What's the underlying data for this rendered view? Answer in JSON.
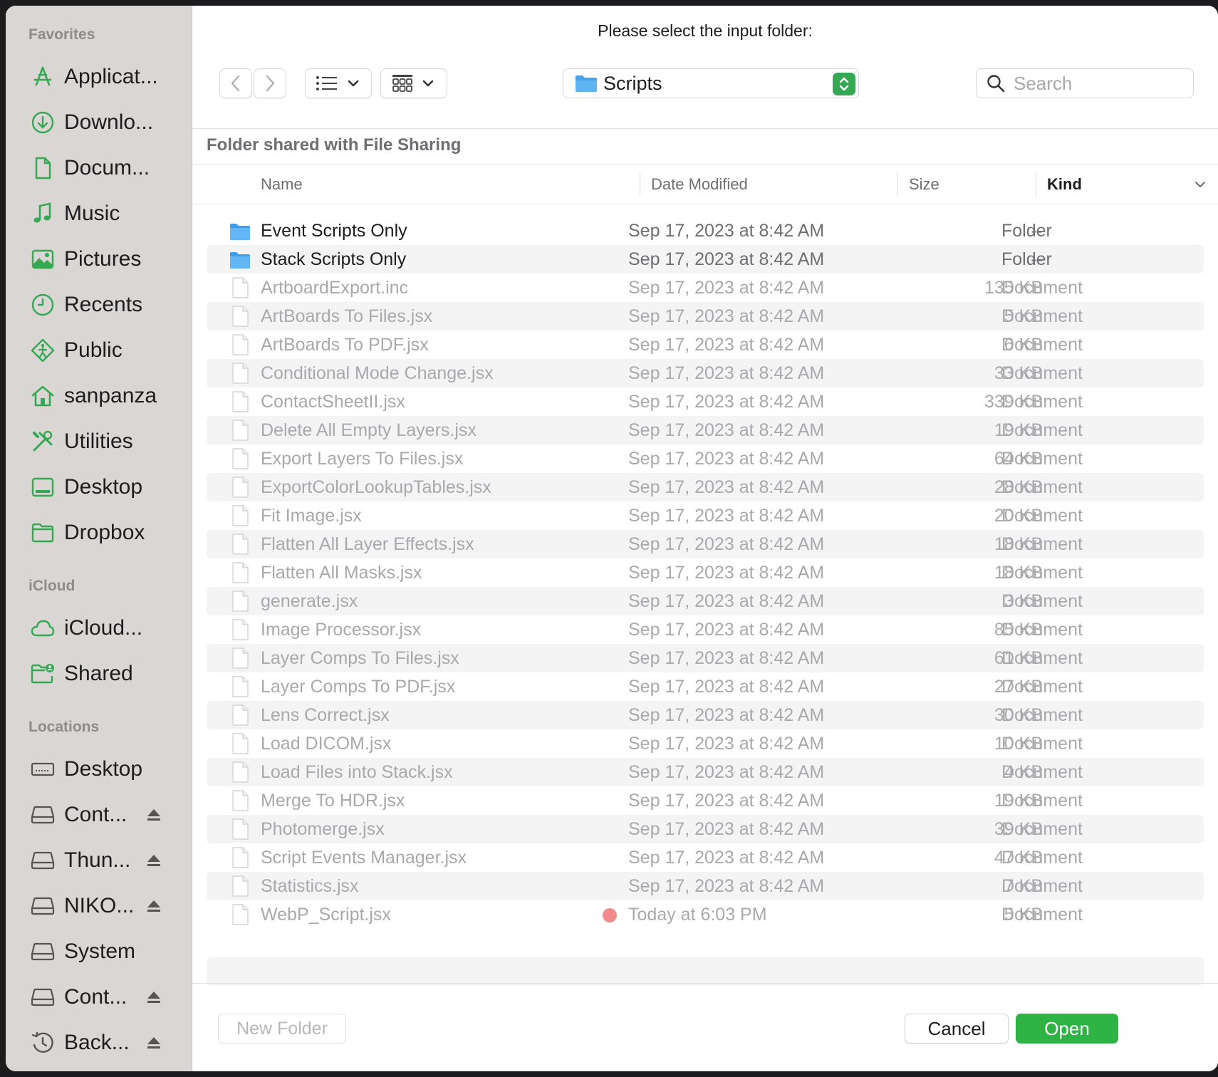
{
  "dialog": {
    "title": "Please select the input folder:"
  },
  "colors": {
    "accent": "#2fb344",
    "sidebar_icon": "#34a853",
    "tag_red": "#f28b8b"
  },
  "sidebar": {
    "sections": [
      {
        "title": "Favorites",
        "items": [
          {
            "label": "Applicat...",
            "icon": "applications-icon"
          },
          {
            "label": "Downlo...",
            "icon": "downloads-icon"
          },
          {
            "label": "Docum...",
            "icon": "document-icon"
          },
          {
            "label": "Music",
            "icon": "music-icon"
          },
          {
            "label": "Pictures",
            "icon": "pictures-icon"
          },
          {
            "label": "Recents",
            "icon": "clock-icon"
          },
          {
            "label": "Public",
            "icon": "public-icon"
          },
          {
            "label": "sanpanza",
            "icon": "home-icon"
          },
          {
            "label": "Utilities",
            "icon": "utilities-icon"
          },
          {
            "label": "Desktop",
            "icon": "desktop-icon"
          },
          {
            "label": "Dropbox",
            "icon": "folder-icon"
          }
        ]
      },
      {
        "title": "iCloud",
        "items": [
          {
            "label": "iCloud...",
            "icon": "cloud-icon"
          },
          {
            "label": "Shared",
            "icon": "shared-folder-icon"
          }
        ]
      },
      {
        "title": "Locations",
        "items": [
          {
            "label": "Desktop",
            "icon": "computer-icon"
          },
          {
            "label": "Cont...",
            "icon": "drive-icon",
            "eject": true
          },
          {
            "label": "Thun...",
            "icon": "drive-icon",
            "eject": true
          },
          {
            "label": "NIKO...",
            "icon": "drive-icon",
            "eject": true
          },
          {
            "label": "System",
            "icon": "drive-icon"
          },
          {
            "label": "Cont...",
            "icon": "drive-icon",
            "eject": true
          },
          {
            "label": "Back...",
            "icon": "time-machine-icon",
            "eject": true
          }
        ]
      }
    ]
  },
  "toolbar": {
    "path": "Scripts",
    "search_placeholder": "Search"
  },
  "location_banner": "Folder shared with File Sharing",
  "columns": {
    "name": "Name",
    "date": "Date Modified",
    "size": "Size",
    "kind": "Kind"
  },
  "files": [
    {
      "name": "Event Scripts Only",
      "date": "Sep 17, 2023 at 8:42 AM",
      "size": "--",
      "kind": "Folder",
      "type": "folder"
    },
    {
      "name": "Stack Scripts Only",
      "date": "Sep 17, 2023 at 8:42 AM",
      "size": "--",
      "kind": "Folder",
      "type": "folder"
    },
    {
      "name": "ArtboardExport.inc",
      "date": "Sep 17, 2023 at 8:42 AM",
      "size": "135 KB",
      "kind": "Document",
      "type": "doc"
    },
    {
      "name": "ArtBoards To Files.jsx",
      "date": "Sep 17, 2023 at 8:42 AM",
      "size": "5 KB",
      "kind": "Document",
      "type": "doc"
    },
    {
      "name": "ArtBoards To PDF.jsx",
      "date": "Sep 17, 2023 at 8:42 AM",
      "size": "6 KB",
      "kind": "Document",
      "type": "doc"
    },
    {
      "name": "Conditional Mode Change.jsx",
      "date": "Sep 17, 2023 at 8:42 AM",
      "size": "33 KB",
      "kind": "Document",
      "type": "doc"
    },
    {
      "name": "ContactSheetII.jsx",
      "date": "Sep 17, 2023 at 8:42 AM",
      "size": "339 KB",
      "kind": "Document",
      "type": "doc"
    },
    {
      "name": "Delete All Empty Layers.jsx",
      "date": "Sep 17, 2023 at 8:42 AM",
      "size": "19 KB",
      "kind": "Document",
      "type": "doc"
    },
    {
      "name": "Export Layers To Files.jsx",
      "date": "Sep 17, 2023 at 8:42 AM",
      "size": "64 KB",
      "kind": "Document",
      "type": "doc"
    },
    {
      "name": "ExportColorLookupTables.jsx",
      "date": "Sep 17, 2023 at 8:42 AM",
      "size": "28 KB",
      "kind": "Document",
      "type": "doc"
    },
    {
      "name": "Fit Image.jsx",
      "date": "Sep 17, 2023 at 8:42 AM",
      "size": "20 KB",
      "kind": "Document",
      "type": "doc"
    },
    {
      "name": "Flatten All Layer Effects.jsx",
      "date": "Sep 17, 2023 at 8:42 AM",
      "size": "18 KB",
      "kind": "Document",
      "type": "doc"
    },
    {
      "name": "Flatten All Masks.jsx",
      "date": "Sep 17, 2023 at 8:42 AM",
      "size": "18 KB",
      "kind": "Document",
      "type": "doc"
    },
    {
      "name": "generate.jsx",
      "date": "Sep 17, 2023 at 8:42 AM",
      "size": "3 KB",
      "kind": "Document",
      "type": "doc"
    },
    {
      "name": "Image Processor.jsx",
      "date": "Sep 17, 2023 at 8:42 AM",
      "size": "85 KB",
      "kind": "Document",
      "type": "doc"
    },
    {
      "name": "Layer Comps To Files.jsx",
      "date": "Sep 17, 2023 at 8:42 AM",
      "size": "61 KB",
      "kind": "Document",
      "type": "doc"
    },
    {
      "name": "Layer Comps To PDF.jsx",
      "date": "Sep 17, 2023 at 8:42 AM",
      "size": "27 KB",
      "kind": "Document",
      "type": "doc"
    },
    {
      "name": "Lens Correct.jsx",
      "date": "Sep 17, 2023 at 8:42 AM",
      "size": "30 KB",
      "kind": "Document",
      "type": "doc"
    },
    {
      "name": "Load DICOM.jsx",
      "date": "Sep 17, 2023 at 8:42 AM",
      "size": "10 KB",
      "kind": "Document",
      "type": "doc"
    },
    {
      "name": "Load Files into Stack.jsx",
      "date": "Sep 17, 2023 at 8:42 AM",
      "size": "4 KB",
      "kind": "Document",
      "type": "doc"
    },
    {
      "name": "Merge To HDR.jsx",
      "date": "Sep 17, 2023 at 8:42 AM",
      "size": "19 KB",
      "kind": "Document",
      "type": "doc"
    },
    {
      "name": "Photomerge.jsx",
      "date": "Sep 17, 2023 at 8:42 AM",
      "size": "39 KB",
      "kind": "Document",
      "type": "doc"
    },
    {
      "name": "Script Events Manager.jsx",
      "date": "Sep 17, 2023 at 8:42 AM",
      "size": "47 KB",
      "kind": "Document",
      "type": "doc"
    },
    {
      "name": "Statistics.jsx",
      "date": "Sep 17, 2023 at 8:42 AM",
      "size": "7 KB",
      "kind": "Document",
      "type": "doc"
    },
    {
      "name": "WebP_Script.jsx",
      "date": "Today at 6:03 PM",
      "size": "5 KB",
      "kind": "Document",
      "type": "doc",
      "tag": "red"
    }
  ],
  "buttons": {
    "new_folder": "New Folder",
    "cancel": "Cancel",
    "open": "Open"
  }
}
